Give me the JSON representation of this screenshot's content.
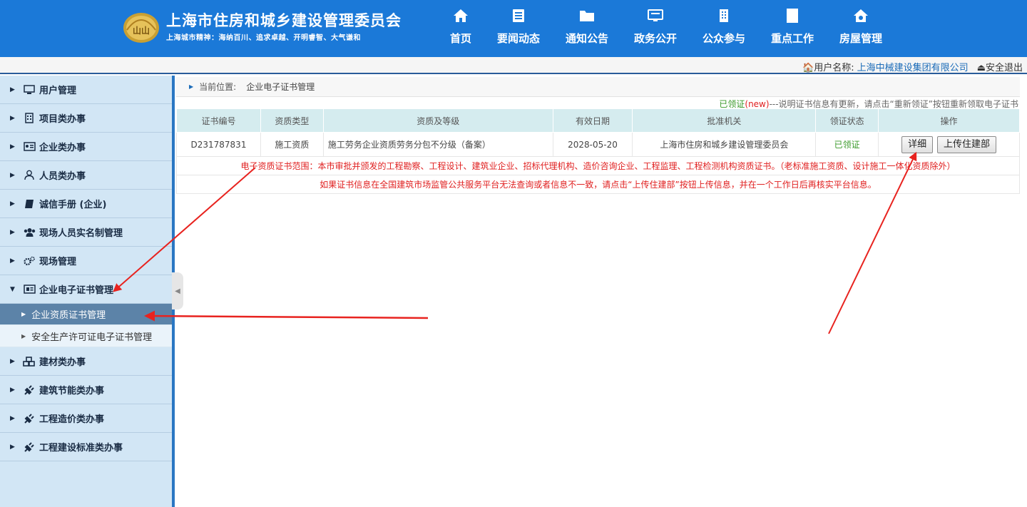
{
  "header": {
    "title": "上海市住房和城乡建设管理委员会",
    "motto": "上海城市精神：海纳百川、追求卓越、开明睿智、大气谦和",
    "emblem_text": "山山",
    "nav": [
      {
        "label": "首页",
        "icon": "home-icon"
      },
      {
        "label": "要闻动态",
        "icon": "news-icon"
      },
      {
        "label": "通知公告",
        "icon": "folder-icon"
      },
      {
        "label": "政务公开",
        "icon": "monitor-icon"
      },
      {
        "label": "公众参与",
        "icon": "buildings-icon"
      },
      {
        "label": "重点工作",
        "icon": "document-icon"
      },
      {
        "label": "房屋管理",
        "icon": "house-gear-icon"
      }
    ]
  },
  "userbar": {
    "user_label": "用户名称:",
    "user_name": "上海中械建设集团有限公司",
    "logout": "安全退出"
  },
  "sidebar": {
    "items": [
      {
        "label": "用户管理",
        "icon": "monitor-icon"
      },
      {
        "label": "项目类办事",
        "icon": "building-icon"
      },
      {
        "label": "企业类办事",
        "icon": "id-card-icon"
      },
      {
        "label": "人员类办事",
        "icon": "person-icon"
      },
      {
        "label": "诚信手册 (企业)",
        "icon": "book-icon"
      },
      {
        "label": "现场人员实名制管理",
        "icon": "users-icon"
      },
      {
        "label": "现场管理",
        "icon": "gears-icon"
      },
      {
        "label": "企业电子证书管理",
        "icon": "newspaper-icon"
      },
      {
        "label": "建材类办事",
        "icon": "cubes-icon"
      },
      {
        "label": "建筑节能类办事",
        "icon": "plug-icon"
      },
      {
        "label": "工程造价类办事",
        "icon": "plug-icon"
      },
      {
        "label": "工程建设标准类办事",
        "icon": "plug-icon"
      }
    ],
    "subitems": [
      {
        "label": "企业资质证书管理"
      },
      {
        "label": "安全生产许可证电子证书管理"
      }
    ]
  },
  "breadcrumb": {
    "label": "当前位置:",
    "current": "企业电子证书管理"
  },
  "notice": {
    "status": "已领证",
    "new_tag": "(new)",
    "text": "---说明证书信息有更新，请点击“重新领证”按钮重新领取电子证书"
  },
  "table": {
    "headers": [
      "证书编号",
      "资质类型",
      "资质及等级",
      "有效日期",
      "批准机关",
      "领证状态",
      "操作"
    ],
    "row": {
      "cert_no": "D231787831",
      "type": "施工资质",
      "grade": "施工劳务企业资质劳务分包不分级（备案）",
      "valid_date": "2028-05-20",
      "authority": "上海市住房和城乡建设管理委员会",
      "status": "已领证",
      "detail_btn": "详细",
      "upload_btn": "上传住建部"
    },
    "note1": "电子资质证书范围：本市审批并颁发的工程勘察、工程设计、建筑业企业、招标代理机构、造价咨询企业、工程监理、工程检测机构资质证书。（老标准施工资质、设计施工一体化资质除外）",
    "note2": "如果证书信息在全国建筑市场监管公共服务平台无法查询或者信息不一致，请点击“上传住建部”按钮上传信息，并在一个工作日后再核实平台信息。"
  },
  "colors": {
    "header_bg": "#1b79d8",
    "sidebar_bg": "#d2e6f5",
    "active_sub_bg": "#5c83a8",
    "table_header_bg": "#d5ecef",
    "annotation_red": "#e8231f"
  }
}
